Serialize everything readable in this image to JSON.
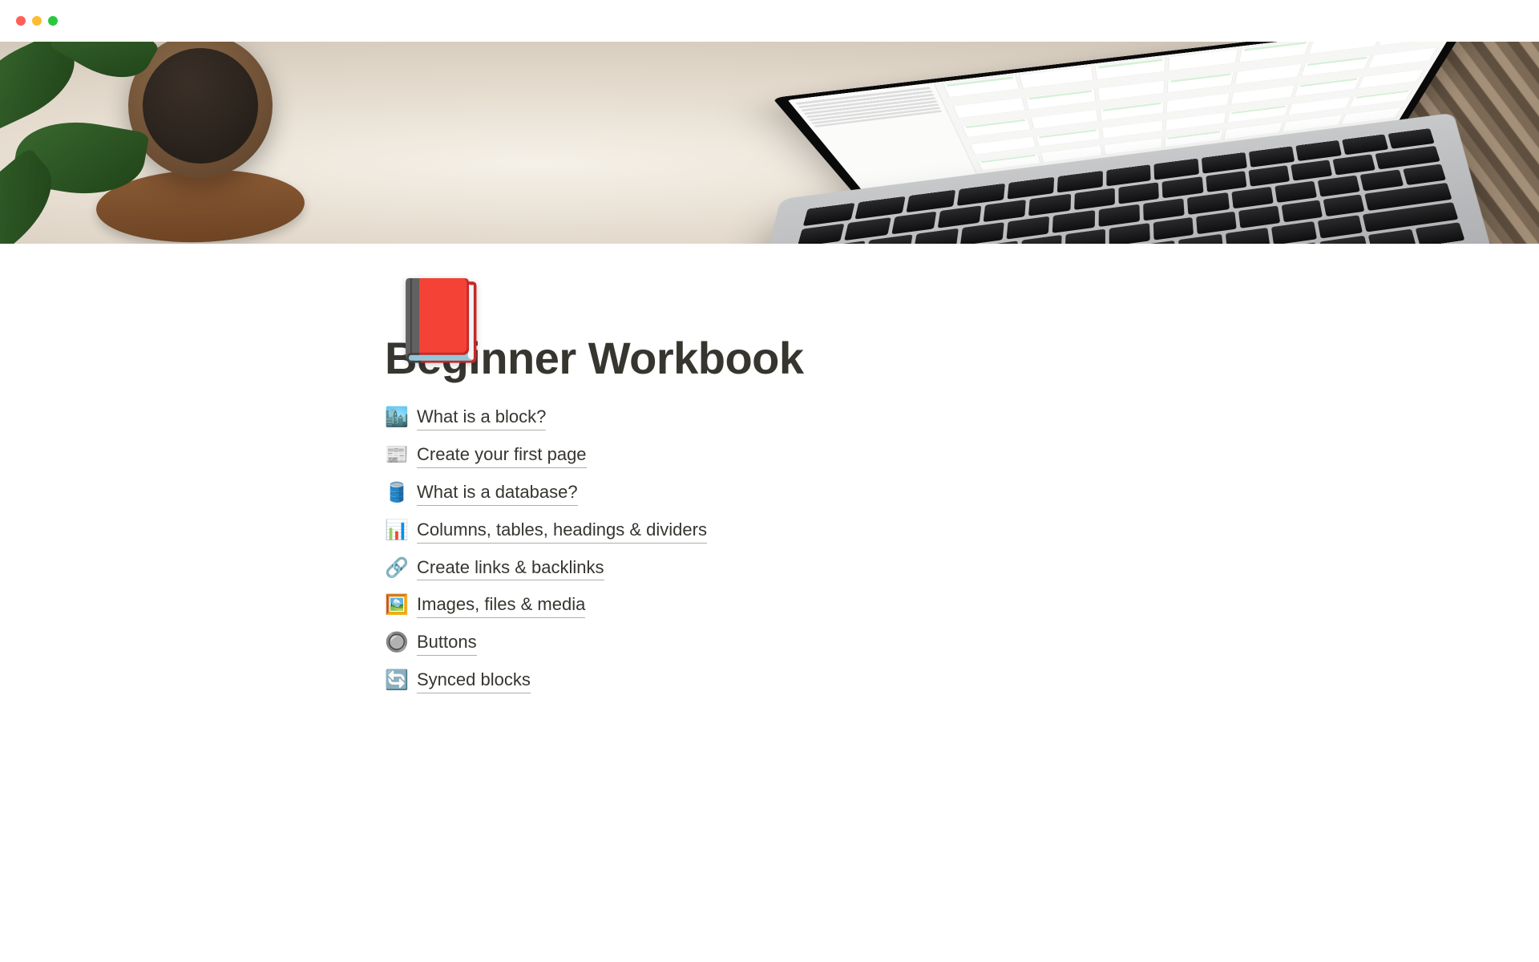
{
  "page": {
    "icon": "📕",
    "title": "Beginner Workbook"
  },
  "links": [
    {
      "icon": "🏙️",
      "label": "What is a block?"
    },
    {
      "icon": "📰",
      "label": "Create your first page"
    },
    {
      "icon": "🛢️",
      "label": "What is a database?"
    },
    {
      "icon": "📊",
      "label": "Columns, tables, headings & dividers"
    },
    {
      "icon": "🔗",
      "label": "Create links & backlinks"
    },
    {
      "icon": "🖼️",
      "label": "Images, files & media"
    },
    {
      "icon": "🔘",
      "label": "Buttons"
    },
    {
      "icon": "🔄",
      "label": "Synced blocks"
    }
  ]
}
